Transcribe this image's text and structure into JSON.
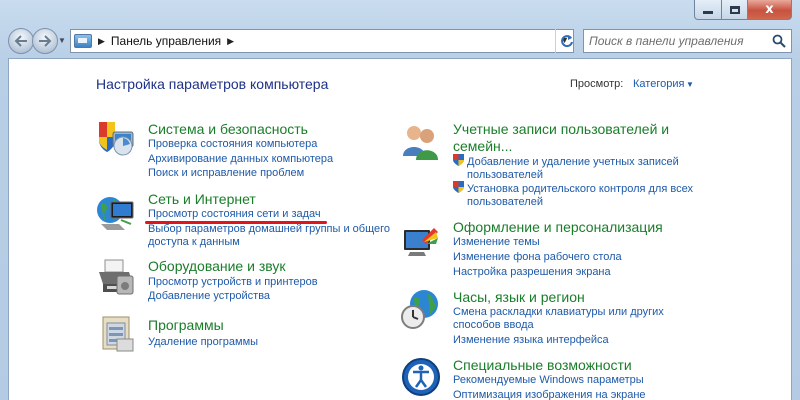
{
  "address_bar": {
    "path": "Панель управления",
    "separator": "▶",
    "trail_arrow": "▶"
  },
  "search": {
    "placeholder": "Поиск в панели управления"
  },
  "caption": {
    "close": "x"
  },
  "content": {
    "title": "Настройка параметров компьютера",
    "view_label": "Просмотр:",
    "view_value": "Категория"
  },
  "categories": {
    "system": {
      "title": "Система и безопасность",
      "icon": "shield-computer-icon",
      "links": [
        "Проверка состояния компьютера",
        "Архивирование данных компьютера",
        "Поиск и исправление проблем"
      ]
    },
    "network": {
      "title": "Сеть и Интернет",
      "icon": "globe-network-icon",
      "links": [
        "Просмотр состояния сети и задач",
        "Выбор параметров домашней группы и общего",
        "доступа к данным"
      ]
    },
    "hardware": {
      "title": "Оборудование и звук",
      "icon": "printer-icon",
      "links": [
        "Просмотр устройств и принтеров",
        "Добавление устройства"
      ]
    },
    "programs": {
      "title": "Программы",
      "icon": "programs-icon",
      "links": [
        "Удаление программы"
      ]
    },
    "users": {
      "title_line1": "Учетные записи пользователей и",
      "title_line2": "семейн...",
      "icon": "users-icon",
      "links": [
        "Добавление и удаление учетных записей",
        "пользователей",
        "Установка родительского контроля для всех",
        "пользователей"
      ]
    },
    "appearance": {
      "title": "Оформление и персонализация",
      "icon": "monitor-palette-icon",
      "links": [
        "Изменение темы",
        "Изменение фона рабочего стола",
        "Настройка разрешения экрана"
      ]
    },
    "clock": {
      "title": "Часы, язык и регион",
      "icon": "globe-clock-icon",
      "links": [
        "Смена раскладки клавиатуры или других",
        "способов ввода",
        "Изменение языка интерфейса"
      ]
    },
    "access": {
      "title": "Специальные возможности",
      "icon": "accessibility-icon",
      "links": [
        "Рекомендуемые Windows параметры",
        "Оптимизация изображения на экране"
      ]
    }
  },
  "colors": {
    "category_title": "#1a7d2a",
    "link": "#1e5aa8",
    "heading": "#1e3287",
    "highlight_underline": "#e0141b"
  }
}
